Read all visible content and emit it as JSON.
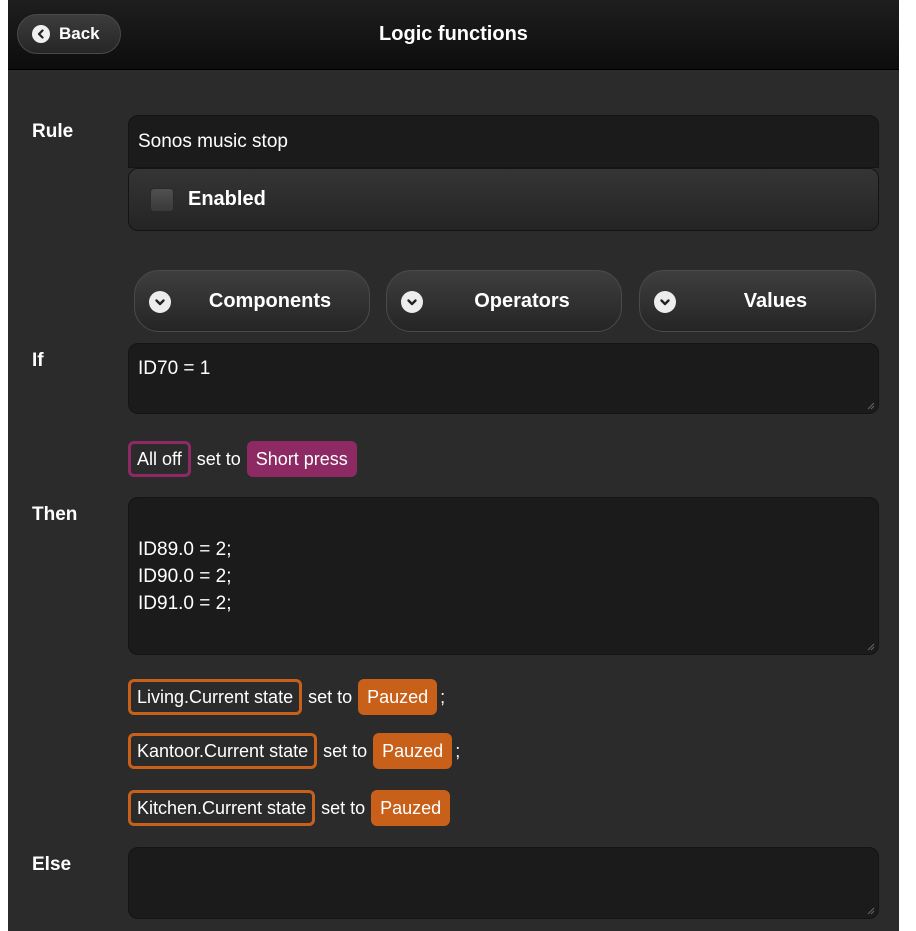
{
  "header": {
    "back_label": "Back",
    "title": "Logic functions"
  },
  "rule": {
    "label": "Rule",
    "value": "Sonos music stop",
    "enabled_label": "Enabled",
    "enabled": false
  },
  "toolbar": {
    "components_label": "Components",
    "operators_label": "Operators",
    "values_label": "Values"
  },
  "if": {
    "label": "If",
    "expression": "ID70 = 1",
    "description": {
      "component": "All off",
      "set_to": "set to",
      "value": "Short press"
    }
  },
  "then": {
    "label": "Then",
    "expression": "ID89.0 = 2;\nID90.0 = 2;\nID91.0 = 2;",
    "descriptions": [
      {
        "component": "Living.Current state",
        "set_to": "set to",
        "value": "Pauzed",
        "suffix": ";"
      },
      {
        "component": "Kantoor.Current state",
        "set_to": "set to",
        "value": "Pauzed",
        "suffix": ";"
      },
      {
        "component": "Kitchen.Current state",
        "set_to": "set to",
        "value": "Pauzed",
        "suffix": ""
      }
    ]
  },
  "else": {
    "label": "Else",
    "expression": ""
  },
  "colors": {
    "background": "#2b2b2b",
    "header": "#111111",
    "field": "#1b1b1b",
    "if_chip": "#8d2a63",
    "then_chip": "#c8601a"
  }
}
